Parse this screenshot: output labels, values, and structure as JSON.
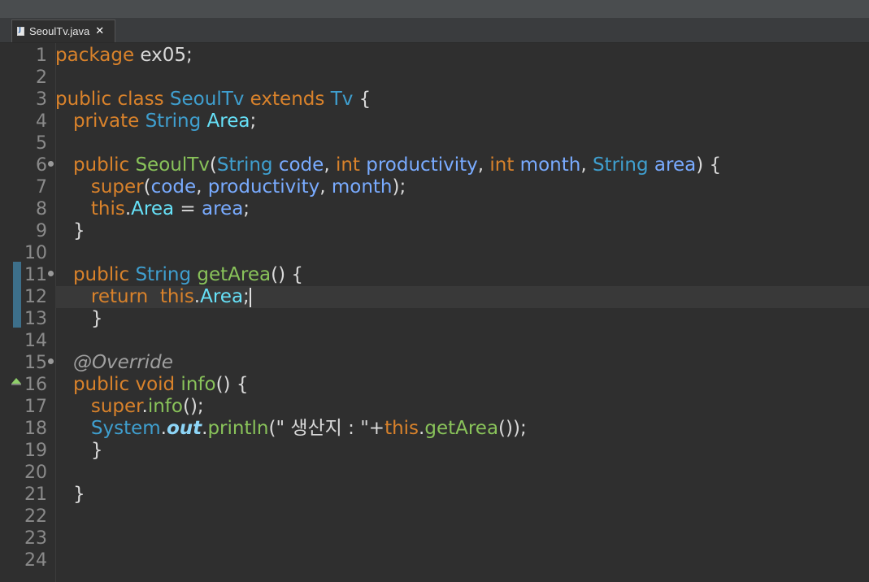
{
  "editor_tab": {
    "filename": "SeoulTv.java",
    "icon": "java-file-icon",
    "close_glyph": "✕"
  },
  "line_numbers": [
    "1",
    "2",
    "3",
    "4",
    "5",
    "6",
    "7",
    "8",
    "9",
    "10",
    "11",
    "12",
    "13",
    "14",
    "15",
    "16",
    "17",
    "18",
    "19",
    "20",
    "21",
    "22",
    "23",
    "24"
  ],
  "code": {
    "l1": {
      "kw_package": "package",
      "pkg": " ex05;"
    },
    "l3": {
      "kw_public": "public",
      "kw_class": " class ",
      "classname": "SeoulTv",
      "kw_extends": " extends ",
      "supername": "Tv",
      "brace": " {"
    },
    "l4": {
      "indent": "   ",
      "kw_private": "private",
      "type": " String",
      "field": " Area",
      "semi": ";"
    },
    "l6": {
      "indent": "   ",
      "kw_public": "public",
      "ctor": " SeoulTv",
      "p1": "(",
      "t1": "String",
      "v1": " code",
      "c1": ", ",
      "t2": "int",
      "v2": " productivity",
      "c2": ", ",
      "t3": "int",
      "v3": " month",
      "c3": ", ",
      "t4": "String",
      "v4": " area",
      "end": ") {"
    },
    "l7": {
      "indent": "      ",
      "kw_super": "super",
      "p": "(",
      "a1": "code",
      "c1": ", ",
      "a2": "productivity",
      "c2": ", ",
      "a3": "month",
      "end": ");"
    },
    "l8": {
      "indent": "      ",
      "kw_this": "this",
      "dot": ".",
      "field": "Area",
      "eq": " = ",
      "var": "area",
      "semi": ";"
    },
    "l9": {
      "indent": "   ",
      "brace": "}"
    },
    "l11": {
      "indent": "   ",
      "kw_public": "public",
      "type": " String",
      "method": " getArea",
      "end": "() {"
    },
    "l12": {
      "indent": "      ",
      "kw_return": "return",
      "sp": "  ",
      "kw_this": "this",
      "dot": ".",
      "field": "Area",
      "semi": ";"
    },
    "l13": {
      "indent": "      ",
      "brace": "}"
    },
    "l15": {
      "indent": "   ",
      "annotation": "@Override"
    },
    "l16": {
      "indent": "   ",
      "kw_public": "public",
      "kw_void": " void",
      "method": " info",
      "end": "() {"
    },
    "l17": {
      "indent": "      ",
      "kw_super": "super",
      "dot": ".",
      "method": "info",
      "end": "();"
    },
    "l18": {
      "indent": "      ",
      "type": "System",
      "dot1": ".",
      "static_field": "out",
      "dot2": ".",
      "method": "println",
      "p": "(",
      "string": "\" 생산지 : \"",
      "plus": "+",
      "kw_this": "this",
      "dot3": ".",
      "method2": "getArea",
      "end": "());"
    },
    "l19": {
      "indent": "      ",
      "brace": "}"
    },
    "l21": {
      "indent": "   ",
      "brace": "}"
    }
  },
  "colors": {
    "background": "#2f2f2f",
    "keyword": "#d9822b",
    "type": "#3f9fcf",
    "field": "#66e1f8",
    "variable": "#79abff",
    "method": "#89c35a",
    "annotation": "#a0a0a0"
  }
}
